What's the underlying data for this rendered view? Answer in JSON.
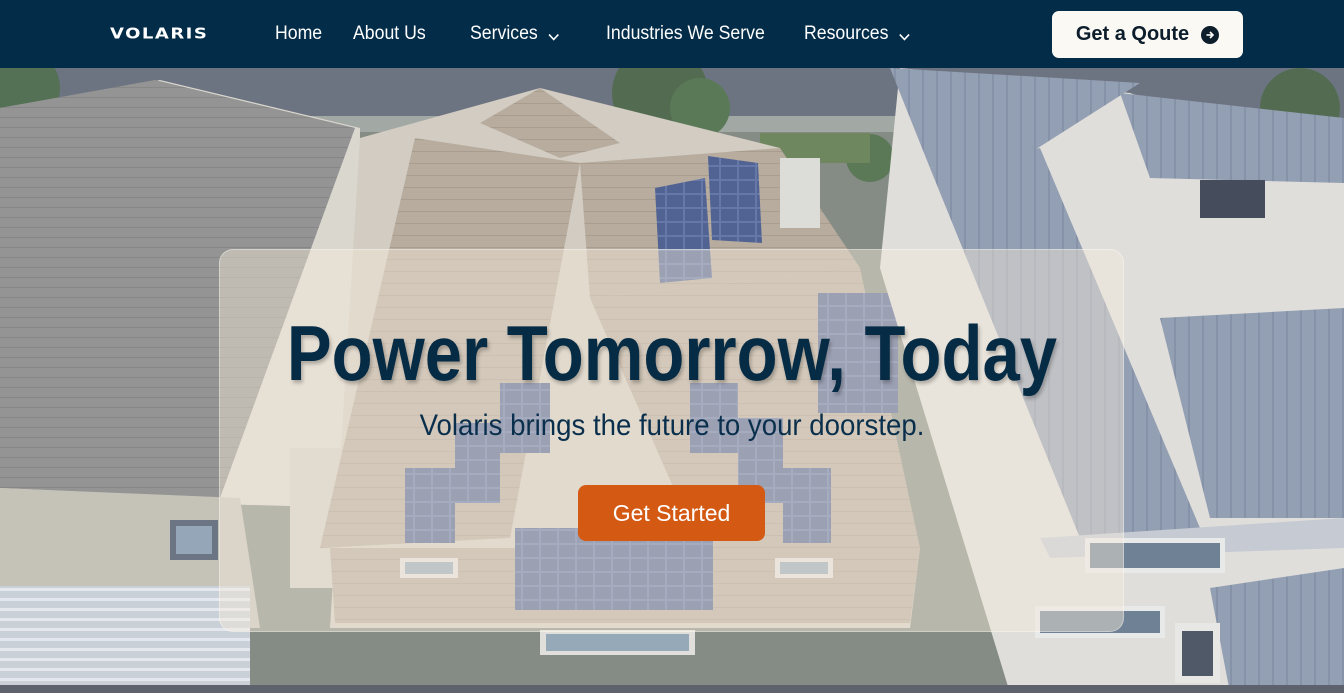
{
  "brand": {
    "logo_text": "VOLARIS"
  },
  "nav": {
    "items": [
      {
        "label": "Home",
        "has_dropdown": false
      },
      {
        "label": "About Us",
        "has_dropdown": false
      },
      {
        "label": "Services",
        "has_dropdown": true
      },
      {
        "label": "Industries We Serve",
        "has_dropdown": false
      },
      {
        "label": "Resources",
        "has_dropdown": true
      }
    ],
    "cta_label": "Get a Qoute",
    "cta_icon": "arrow-right-circle-icon"
  },
  "hero": {
    "title": "Power Tomorrow, Today",
    "subtitle": "Volaris brings the future to your doorstep.",
    "button_label": "Get Started",
    "background_image": "aerial-rooftops-with-solar-panels"
  },
  "colors": {
    "navbar": "#032c48",
    "accent": "#d45a14",
    "title": "#052b45",
    "cta_bg": "#fbf9f4"
  }
}
